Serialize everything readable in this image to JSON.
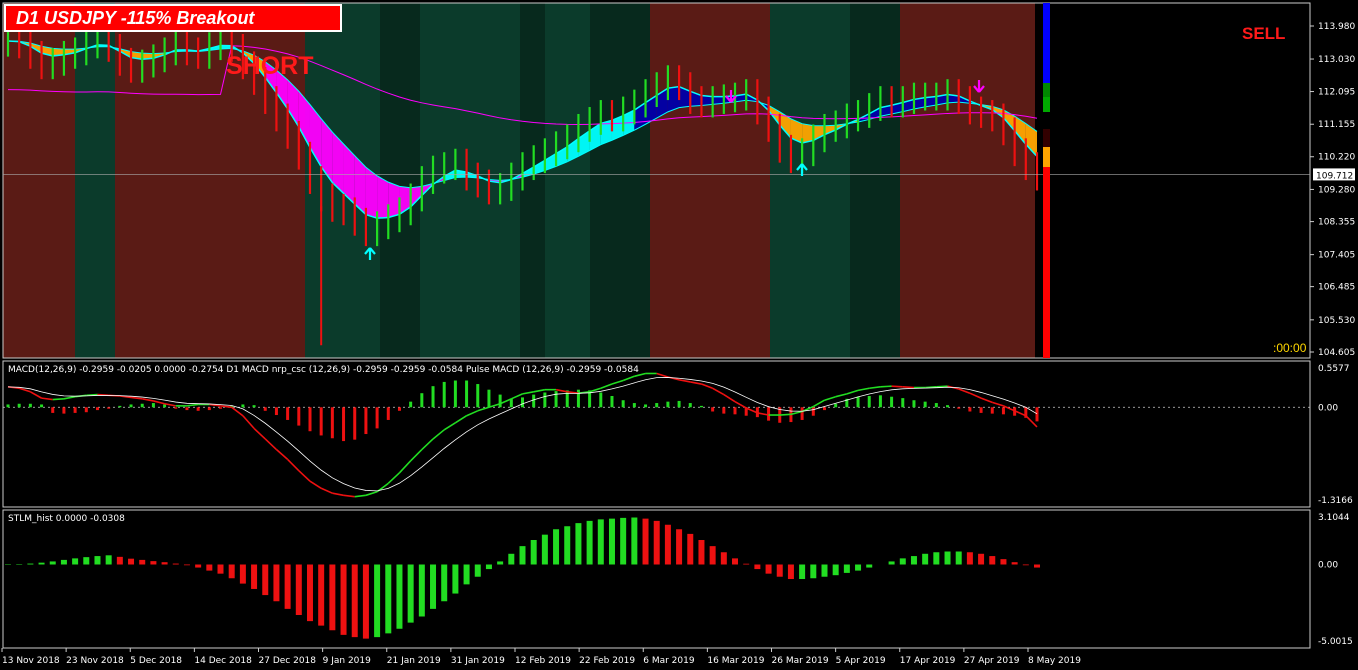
{
  "header": {
    "title": "D1 USDJPY  -115% Breakout",
    "signal_short": "SHORT",
    "signal_sell": "SELL",
    "timer": ":00:00"
  },
  "colors": {
    "bg": "#000000",
    "bull_zone": "#0b3b2b",
    "bull_zone_dark": "#07291d",
    "bear_zone": "#5a1b15",
    "up": "#22dd22",
    "down": "#ee1111",
    "cyan": "#00ffff",
    "orange": "#ffa500",
    "magenta": "#ff00ff",
    "blue": "#0000aa"
  },
  "chart_data": [
    {
      "type": "candlestick",
      "title": "D1 USDJPY",
      "x_labels": [
        "13 Nov 2018",
        "23 Nov 2018",
        "5 Dec 2018",
        "14 Dec 2018",
        "27 Dec 2018",
        "9 Jan 2019",
        "21 Jan 2019",
        "31 Jan 2019",
        "12 Feb 2019",
        "22 Feb 2019",
        "6 Mar 2019",
        "16 Mar 2019",
        "26 Mar 2019",
        "5 Apr 2019",
        "17 Apr 2019",
        "27 Apr 2019",
        "8 May 2019"
      ],
      "y_ticks": [
        113.98,
        113.03,
        112.095,
        111.155,
        110.22,
        109.28,
        108.355,
        107.405,
        106.485,
        105.53,
        104.605
      ],
      "ylim": [
        104.605,
        113.98
      ],
      "current_price": 109.712,
      "close_series": [
        113.55,
        113.5,
        113.2,
        112.9,
        113.0,
        113.2,
        113.3,
        113.5,
        113.6,
        113.4,
        113.0,
        112.8,
        112.95,
        113.1,
        113.3,
        113.5,
        113.3,
        113.2,
        113.45,
        113.55,
        113.4,
        112.9,
        112.45,
        111.9,
        111.4,
        110.9,
        110.3,
        109.6,
        109.1,
        108.8,
        108.7,
        108.4,
        108.1,
        108.3,
        108.5,
        108.7,
        109.1,
        109.6,
        109.9,
        110.0,
        110.1,
        109.7,
        109.5,
        109.3,
        109.4,
        109.7,
        110.0,
        110.2,
        110.4,
        110.6,
        110.8,
        111.1,
        111.3,
        111.5,
        111.4,
        111.6,
        111.8,
        112.1,
        112.3,
        112.5,
        112.3,
        111.9,
        111.8,
        111.9,
        111.95,
        112.0,
        112.1,
        111.6,
        111.1,
        110.5,
        110.2,
        110.4,
        110.8,
        111.1,
        111.2,
        111.4,
        111.5,
        111.7,
        111.9,
        111.8,
        111.9,
        112.0,
        112.0,
        112.0,
        112.1,
        111.9,
        111.6,
        111.5,
        111.4,
        111.0,
        110.4,
        110.0,
        109.7
      ]
    },
    {
      "type": "line",
      "title": "MACD",
      "legend_text": "MACD(12,26,9) -0.2959 -0.0205 0.0000 -0.2754  D1 MACD nrp_csc (12,26,9) -0.2959 -0.2959 -0.0584  Pulse MACD (12,26,9) -0.2959 -0.0584",
      "y_ticks": [
        0.5577,
        0.0,
        -1.3166
      ],
      "ylim": [
        -1.3166,
        0.5577
      ],
      "histogram": [
        0.04,
        0.05,
        0.05,
        0.04,
        -0.08,
        -0.09,
        -0.08,
        -0.07,
        -0.04,
        -0.02,
        0.02,
        0.04,
        0.05,
        0.06,
        0.04,
        -0.02,
        -0.04,
        -0.05,
        -0.04,
        -0.02,
        0.02,
        0.04,
        0.03,
        -0.05,
        -0.11,
        -0.18,
        -0.26,
        -0.34,
        -0.4,
        -0.44,
        -0.48,
        -0.46,
        -0.38,
        -0.3,
        -0.18,
        -0.05,
        0.08,
        0.2,
        0.3,
        0.36,
        0.38,
        0.38,
        0.33,
        0.25,
        0.18,
        0.12,
        0.14,
        0.18,
        0.21,
        0.23,
        0.24,
        0.25,
        0.24,
        0.21,
        0.16,
        0.1,
        0.06,
        0.04,
        0.06,
        0.08,
        0.09,
        0.06,
        0.02,
        -0.06,
        -0.09,
        -0.1,
        -0.12,
        -0.14,
        -0.19,
        -0.22,
        -0.21,
        -0.18,
        -0.12,
        -0.04,
        0.05,
        0.12,
        0.15,
        0.16,
        0.17,
        0.15,
        0.13,
        0.1,
        0.08,
        0.06,
        0.03,
        -0.02,
        -0.06,
        -0.08,
        -0.09,
        -0.1,
        -0.12,
        -0.15,
        -0.2
      ],
      "macd_line": [
        0.29,
        0.27,
        0.22,
        0.13,
        0.11,
        0.12,
        0.15,
        0.17,
        0.18,
        0.17,
        0.16,
        0.14,
        0.12,
        0.09,
        0.05,
        0.02,
        0.02,
        0.04,
        0.04,
        0.02,
        0.0,
        -0.12,
        -0.3,
        -0.45,
        -0.6,
        -0.74,
        -0.9,
        -1.05,
        -1.15,
        -1.22,
        -1.25,
        -1.27,
        -1.25,
        -1.2,
        -1.08,
        -0.93,
        -0.76,
        -0.6,
        -0.45,
        -0.32,
        -0.22,
        -0.12,
        -0.05,
        0.0,
        0.05,
        0.12,
        0.19,
        0.22,
        0.25,
        0.25,
        0.22,
        0.2,
        0.22,
        0.27,
        0.33,
        0.38,
        0.44,
        0.48,
        0.48,
        0.43,
        0.39,
        0.36,
        0.33,
        0.27,
        0.18,
        0.08,
        -0.01,
        -0.08,
        -0.11,
        -0.11,
        -0.1,
        -0.06,
        0.01,
        0.1,
        0.15,
        0.19,
        0.24,
        0.27,
        0.29,
        0.3,
        0.29,
        0.28,
        0.28,
        0.29,
        0.3,
        0.26,
        0.2,
        0.13,
        0.07,
        0.02,
        -0.05,
        -0.12,
        -0.28
      ]
    },
    {
      "type": "bar",
      "title": "STLM_hist",
      "legend_text": "STLM_hist 0.0000 -0.0308",
      "y_ticks": [
        3.1044,
        0.0,
        -5.0015
      ],
      "ylim": [
        -5.0015,
        3.1044
      ],
      "values": [
        -0.03,
        0.03,
        0.06,
        0.12,
        0.2,
        0.3,
        0.4,
        0.48,
        0.55,
        0.6,
        0.5,
        0.38,
        0.3,
        0.22,
        0.15,
        0.06,
        -0.05,
        -0.2,
        -0.4,
        -0.6,
        -0.9,
        -1.25,
        -1.6,
        -2.0,
        -2.4,
        -2.9,
        -3.3,
        -3.7,
        -4.0,
        -4.3,
        -4.6,
        -4.75,
        -4.85,
        -4.75,
        -4.5,
        -4.2,
        -3.8,
        -3.4,
        -2.9,
        -2.4,
        -1.9,
        -1.3,
        -0.8,
        -0.3,
        0.2,
        0.7,
        1.2,
        1.6,
        1.95,
        2.3,
        2.5,
        2.7,
        2.85,
        2.95,
        3.0,
        3.05,
        3.07,
        3.0,
        2.85,
        2.6,
        2.3,
        2.0,
        1.6,
        1.2,
        0.8,
        0.4,
        0.05,
        -0.3,
        -0.6,
        -0.8,
        -0.95,
        -0.95,
        -0.9,
        -0.8,
        -0.7,
        -0.55,
        -0.4,
        -0.2,
        0.0,
        0.2,
        0.4,
        0.55,
        0.7,
        0.8,
        0.85,
        0.85,
        0.8,
        0.7,
        0.55,
        0.35,
        0.15,
        -0.05,
        -0.2
      ]
    }
  ]
}
